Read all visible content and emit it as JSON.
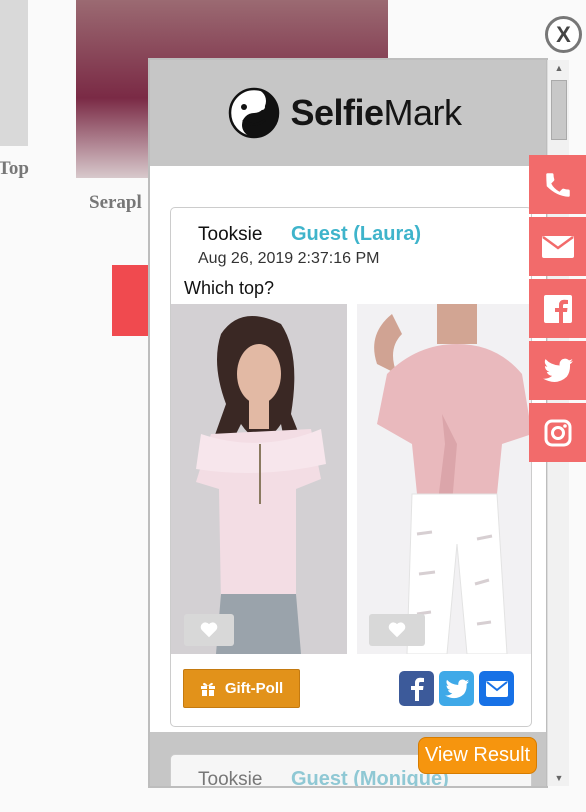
{
  "background": {
    "left_product_label": "Top",
    "main_product_label": "Serapl"
  },
  "close": {
    "label": "X"
  },
  "popup": {
    "logo": {
      "bold": "Selfie",
      "light": "Mark"
    },
    "post": {
      "user": "Tooksie",
      "guest": "Guest (Laura)",
      "date": "Aug 26, 2019 2:37:16 PM",
      "question": "Which top?",
      "giftpoll_label": "Gift-Poll"
    },
    "next_post": {
      "user": "Tooksie",
      "guest": "Guest (Monique)"
    }
  },
  "view_result_label": "View Result",
  "side_icons": [
    "phone-icon",
    "envelope-icon",
    "facebook-icon",
    "twitter-icon",
    "instagram-icon"
  ],
  "share_icons": [
    "facebook-icon",
    "twitter-icon",
    "envelope-icon"
  ],
  "colors": {
    "accent_orange": "#f6950e",
    "guest_teal": "#3fb4cb",
    "side_red": "#f26b6b",
    "facebook": "#3c5a9a",
    "twitter": "#3fa9e8",
    "email": "#1771e6"
  }
}
